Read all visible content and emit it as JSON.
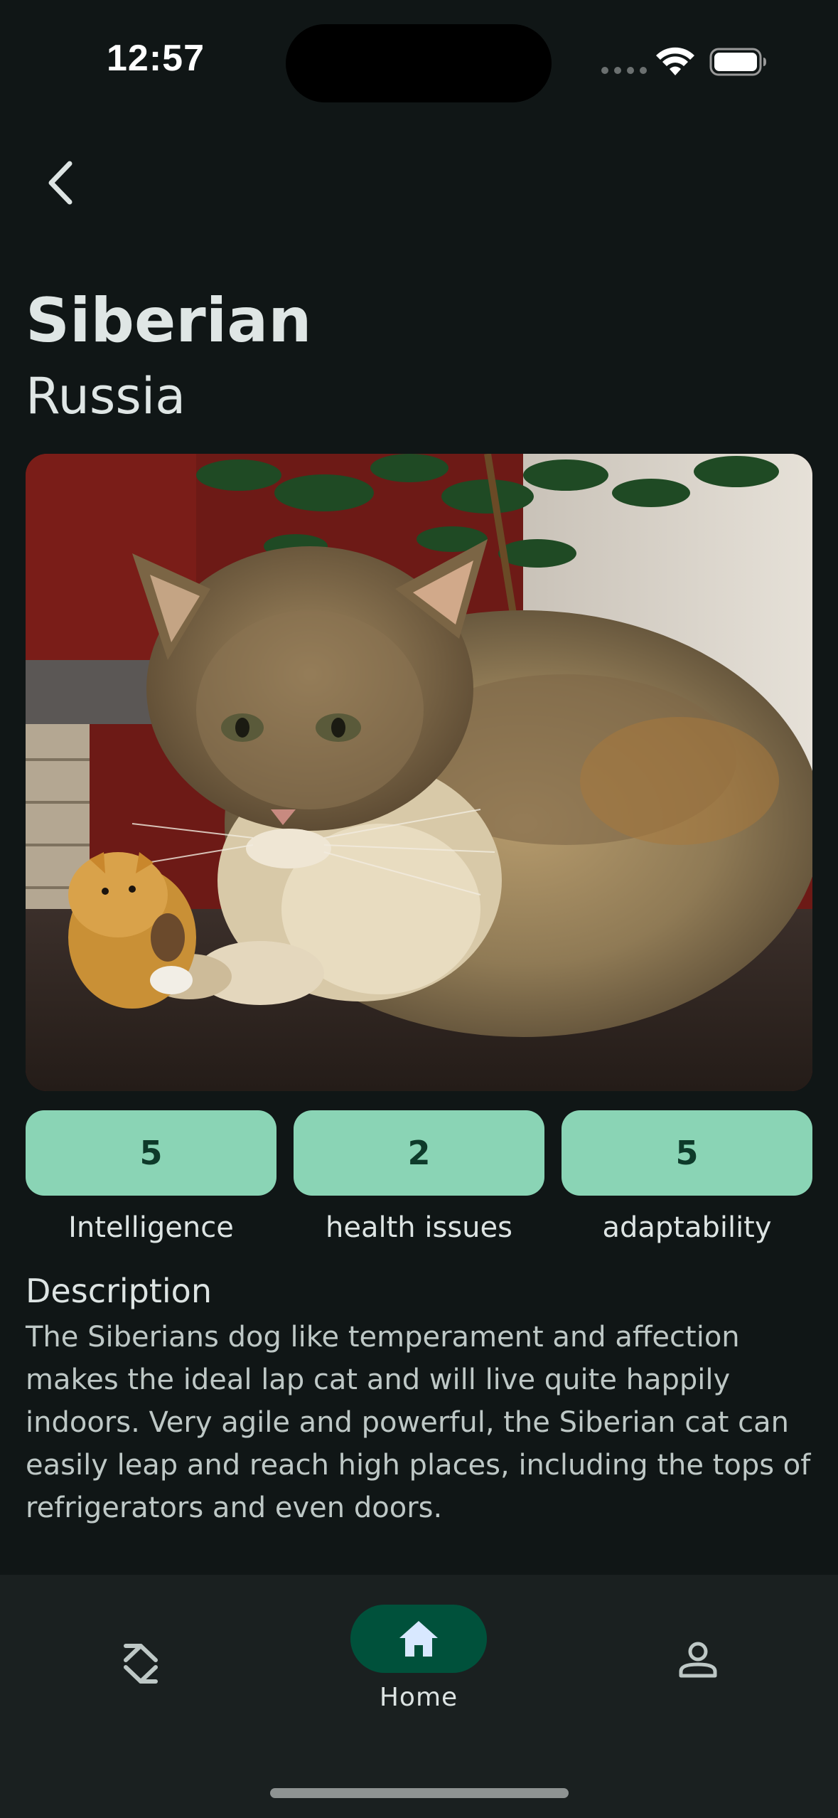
{
  "status_bar": {
    "time": "12:57"
  },
  "header": {
    "back_icon": "chevron-left-icon"
  },
  "breed": {
    "name": "Siberian",
    "origin": "Russia",
    "photo_subject": "long-haired tabby cat with plush toy"
  },
  "stats": [
    {
      "value": "5",
      "label": "Intelligence"
    },
    {
      "value": "2",
      "label": "health issues"
    },
    {
      "value": "5",
      "label": "adaptability"
    }
  ],
  "description": {
    "heading": "Description",
    "text": "The Siberians dog like temperament and affection makes the ideal lap cat and will live quite happily indoors. Very agile and powerful, the Siberian cat can easily leap and reach high places, including the tops of refrigerators and even doors."
  },
  "bottom_nav": {
    "items": [
      {
        "icon": "swap-icon",
        "label": ""
      },
      {
        "icon": "home-icon",
        "label": "Home",
        "selected": true
      },
      {
        "icon": "person-icon",
        "label": ""
      }
    ]
  },
  "colors": {
    "background": "#101616",
    "stat_pill": "#8ad4b5",
    "nav_active": "#00513b",
    "nav_bar": "#1a2020"
  }
}
